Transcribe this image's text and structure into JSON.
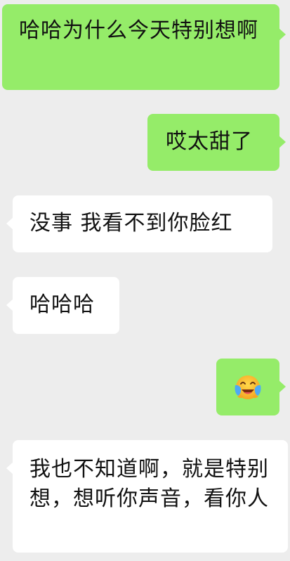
{
  "messages": [
    {
      "side": "mine",
      "text": "哈哈为什么今天特别想啊"
    },
    {
      "side": "mine",
      "text": "哎太甜了"
    },
    {
      "side": "theirs",
      "text": "没事 我看不到你脸红"
    },
    {
      "side": "theirs",
      "text": "哈哈哈"
    },
    {
      "side": "mine",
      "emoji": "loudly-crying-laughing-emoji"
    },
    {
      "side": "theirs",
      "text": "我也不知道啊，就是特别想，想听你声音，看你人"
    }
  ],
  "colors": {
    "background": "#ededed",
    "mine_bubble": "#95ec69",
    "theirs_bubble": "#ffffff",
    "text": "#111111"
  }
}
